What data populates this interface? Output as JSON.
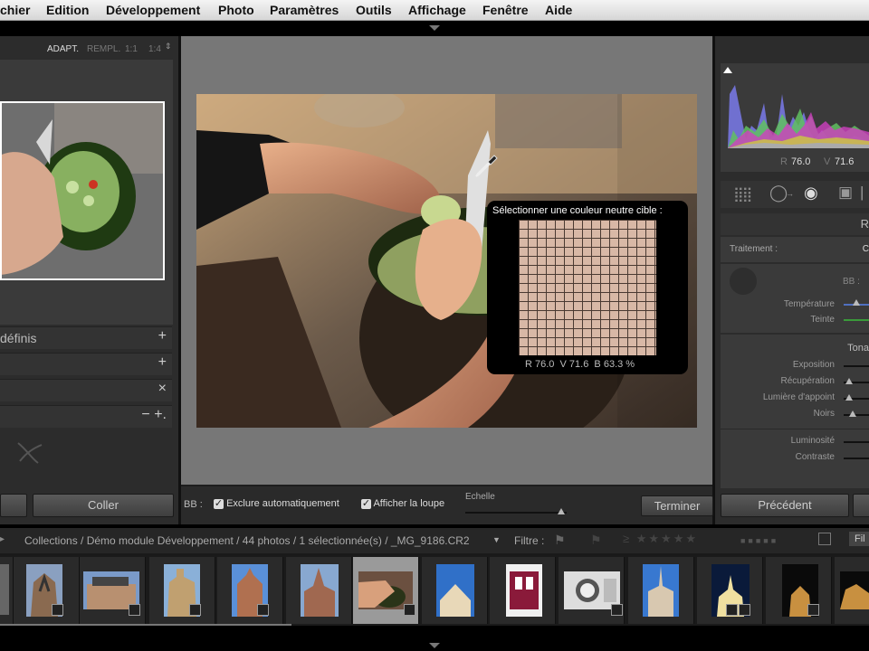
{
  "menu": [
    "chier",
    "Edition",
    "Développement",
    "Photo",
    "Paramètres",
    "Outils",
    "Affichage",
    "Fenêtre",
    "Aide"
  ],
  "navigator": {
    "options": [
      "ADAPT.",
      "REMPL.",
      "1:1",
      "1:4"
    ]
  },
  "left_rows": [
    {
      "label": "définis",
      "icon": "+"
    },
    {
      "label": "",
      "icon": "+"
    },
    {
      "label": "",
      "icon": "×"
    },
    {
      "label": "",
      "icon": "− +."
    }
  ],
  "left_buttons": {
    "paste": "Coller"
  },
  "picker": {
    "title": "Sélectionner une couleur neutre cible :",
    "readout": "R 76.0  V 71.6  B 63.3 %"
  },
  "toolbar": {
    "bb": "BB :",
    "auto_exclude": "Exclure automatiquement",
    "show_loupe": "Afficher la loupe",
    "scale": "Echelle",
    "done": "Terminer",
    "auto_exclude_checked": true,
    "show_loupe_checked": true
  },
  "histogram": {
    "r_label": "R",
    "r_value": "76.0",
    "v_label": "V",
    "v_value": "71.6"
  },
  "basic": {
    "section": "R",
    "treatment": "Traitement :",
    "treatment_value": "C",
    "wb": "BB :",
    "temperature": "Température",
    "tint": "Teinte",
    "tone_section": "Tona",
    "exposure": "Exposition",
    "recovery": "Récupération",
    "fill_light": "Lumière d'appoint",
    "blacks": "Noirs",
    "brightness": "Luminosité",
    "contrast": "Contraste"
  },
  "right_buttons": {
    "previous": "Précédent"
  },
  "filmstrip": {
    "path": "Collections / Démo module Développement / 44 photos / 1 sélectionnée(s) / _MG_9186.CR2",
    "filter": "Filtre :",
    "filter_off": "Fil"
  },
  "colors": {
    "accent_green": "#3a9a3a",
    "selected_thumb": "#9a9a9a"
  }
}
